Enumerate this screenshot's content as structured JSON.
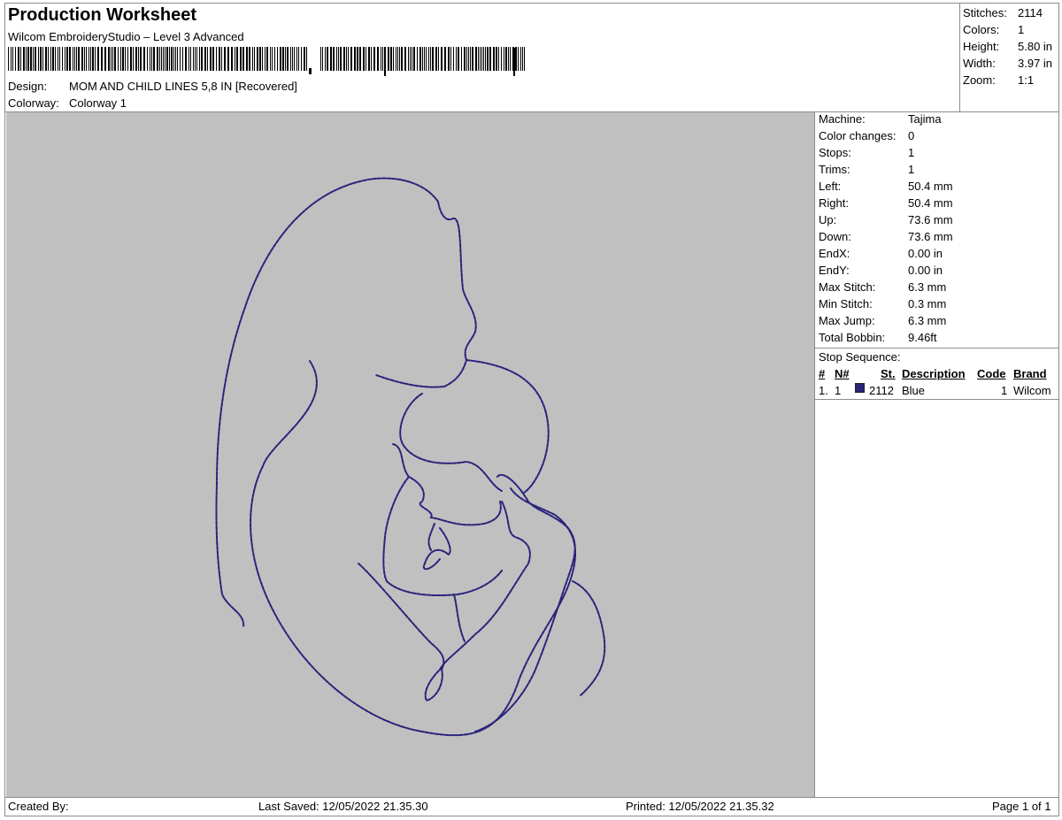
{
  "header": {
    "title": "Production Worksheet",
    "subtitle": "Wilcom EmbroideryStudio – Level 3 Advanced",
    "design_label": "Design:",
    "design_value": "MOM AND CHILD LINES 5,8 IN [Recovered]",
    "colorway_label": "Colorway:",
    "colorway_value": "Colorway 1"
  },
  "summary": {
    "stitches_label": "Stitches:",
    "stitches_value": "2114",
    "colors_label": "Colors:",
    "colors_value": "1",
    "height_label": "Height:",
    "height_value": "5.80 in",
    "width_label": "Width:",
    "width_value": "3.97 in",
    "zoom_label": "Zoom:",
    "zoom_value": "1:1"
  },
  "machine": {
    "rows": [
      {
        "label": "Machine:",
        "value": "Tajima"
      },
      {
        "label": "Color changes:",
        "value": "0"
      },
      {
        "label": "Stops:",
        "value": "1"
      },
      {
        "label": "Trims:",
        "value": "1"
      },
      {
        "label": "Left:",
        "value": "50.4 mm"
      },
      {
        "label": "Right:",
        "value": "50.4 mm"
      },
      {
        "label": "Up:",
        "value": "73.6 mm"
      },
      {
        "label": "Down:",
        "value": "73.6 mm"
      },
      {
        "label": "EndX:",
        "value": "0.00 in"
      },
      {
        "label": "EndY:",
        "value": "0.00 in"
      },
      {
        "label": "Max Stitch:",
        "value": "6.3 mm"
      },
      {
        "label": "Min Stitch:",
        "value": "0.3 mm"
      },
      {
        "label": "Max Jump:",
        "value": "6.3 mm"
      },
      {
        "label": "Total Bobbin:",
        "value": "9.46ft"
      }
    ]
  },
  "stop_sequence": {
    "title": "Stop Sequence:",
    "columns": {
      "num": "#",
      "needle": "N#",
      "stitches": "St.",
      "description": "Description",
      "code": "Code",
      "brand": "Brand"
    },
    "rows": [
      {
        "num": "1.",
        "needle": "1",
        "color": "#2a237a",
        "stitches": "2112",
        "description": "Blue",
        "code": "1",
        "brand": "Wilcom"
      }
    ]
  },
  "footer": {
    "created_by": "Created By:",
    "last_saved": "Last Saved: 12/05/2022 21.35.30",
    "printed": "Printed: 12/05/2022 21.35.32",
    "page": "Page 1 of 1"
  },
  "colors": {
    "canvas": "#c0c0c0",
    "thread": "#2a237a",
    "border": "#8c8c8c"
  }
}
